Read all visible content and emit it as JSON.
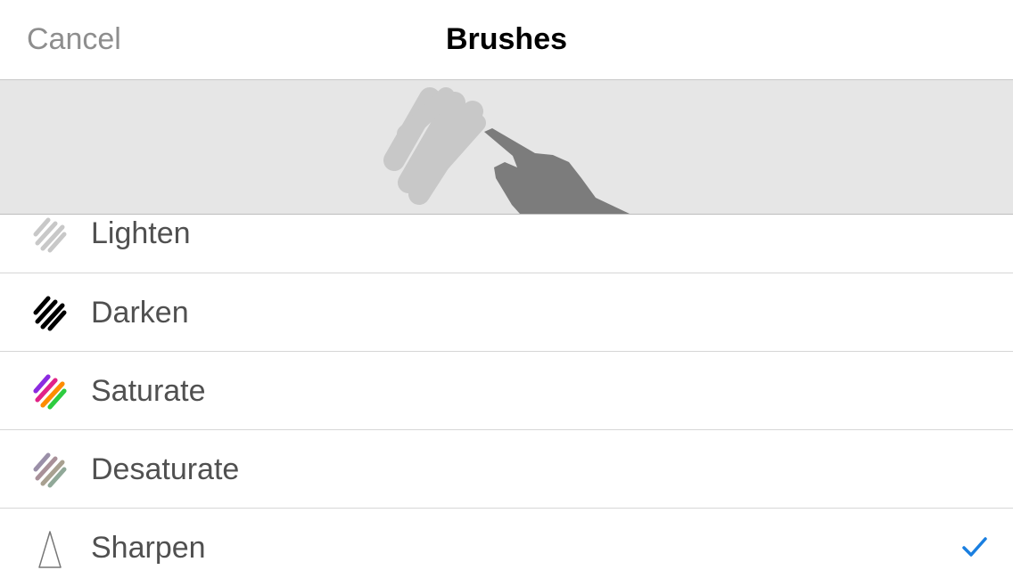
{
  "navbar": {
    "cancel_label": "Cancel",
    "title": "Brushes"
  },
  "colors": {
    "accent": "#1a7fe0",
    "label_text": "#505050",
    "cancel_text": "#8e8e8e",
    "preview_background": "#e6e6e6",
    "preview_scribble": "#c8c8c8",
    "preview_hand": "#7c7c7c"
  },
  "brushes": [
    {
      "label": "Lighten",
      "icon": "lighten-scribble-icon",
      "selected": false
    },
    {
      "label": "Darken",
      "icon": "darken-scribble-icon",
      "selected": false
    },
    {
      "label": "Saturate",
      "icon": "saturate-scribble-icon",
      "selected": false
    },
    {
      "label": "Desaturate",
      "icon": "desaturate-scribble-icon",
      "selected": false
    },
    {
      "label": "Sharpen",
      "icon": "sharpen-cone-icon",
      "selected": true
    }
  ],
  "preview": {
    "icons": [
      "scribble-icon",
      "pointing-hand-icon"
    ]
  }
}
